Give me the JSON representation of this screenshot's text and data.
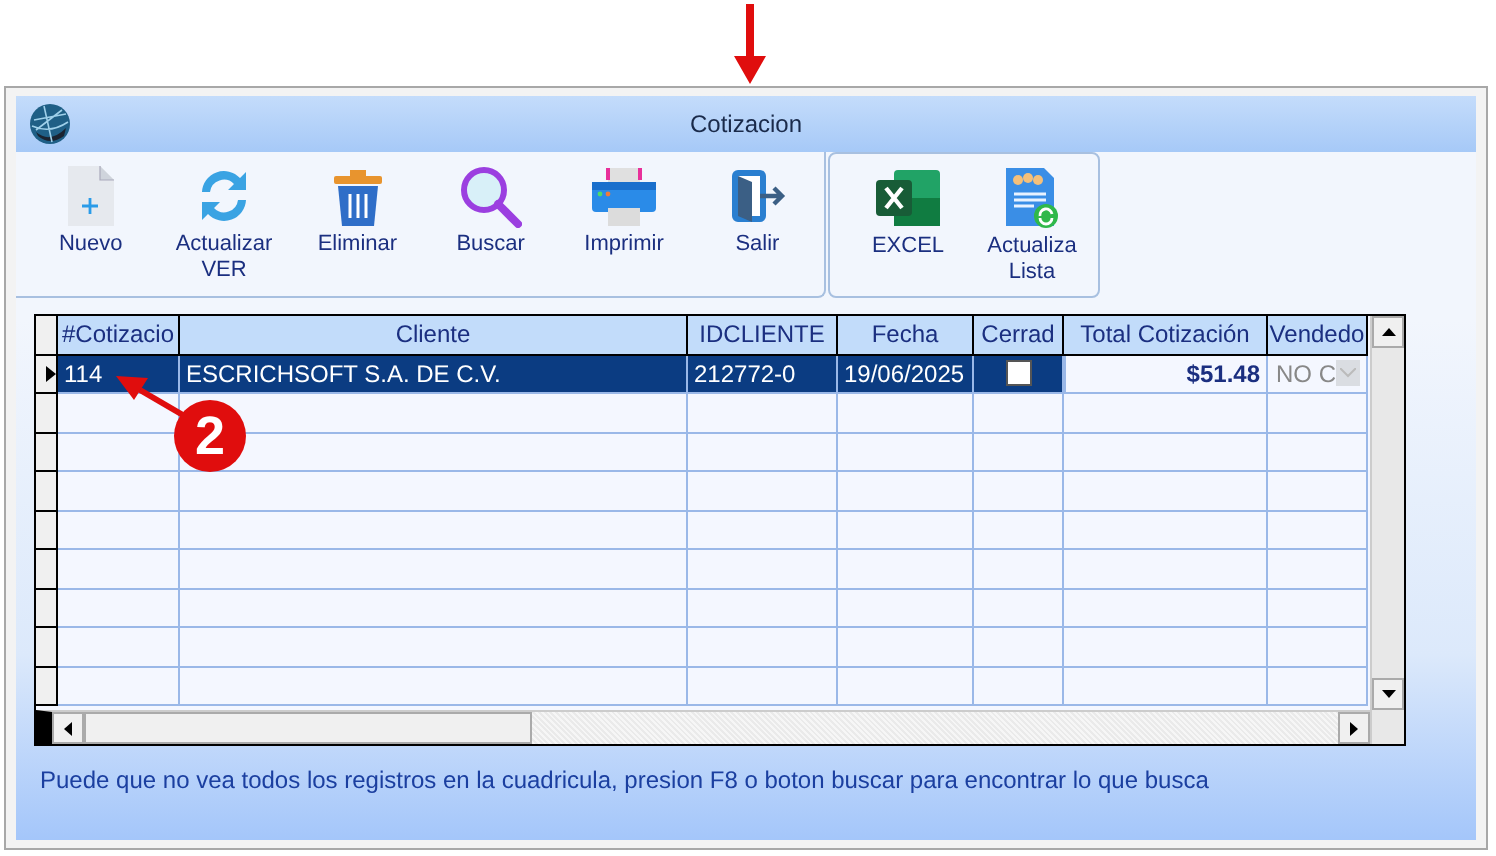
{
  "window": {
    "title": "Cotizacion"
  },
  "toolbar_groups": [
    [
      {
        "label": "Nuevo",
        "kind": "new"
      },
      {
        "label": "Actualizar VER",
        "kind": "refresh"
      },
      {
        "label": "Eliminar",
        "kind": "delete"
      },
      {
        "label": "Buscar",
        "kind": "search"
      },
      {
        "label": "Imprimir",
        "kind": "print"
      },
      {
        "label": "Salir",
        "kind": "exit"
      }
    ],
    [
      {
        "label": "EXCEL",
        "kind": "excel"
      },
      {
        "label": "Actualiza Lista",
        "kind": "list-refresh"
      }
    ]
  ],
  "table": {
    "columns": [
      "#Cotizacio",
      "Cliente",
      "IDCLIENTE",
      "Fecha",
      "Cerrad",
      "Total Cotización",
      "Vendedo"
    ],
    "rows": [
      {
        "selected": true,
        "number": "114",
        "client": "ESCRICHSOFT S.A. DE C.V.",
        "client_id": "212772-0",
        "date": "19/06/2025",
        "closed": false,
        "total": "$51.48",
        "seller": "NO C"
      }
    ]
  },
  "message": "Puede que no vea todos los registros en la cuadricula, presion F8 o boton buscar para encontrar lo que busca",
  "annotations": [
    {
      "kind": "arrow"
    },
    {
      "kind": "callout",
      "label": "2"
    }
  ]
}
